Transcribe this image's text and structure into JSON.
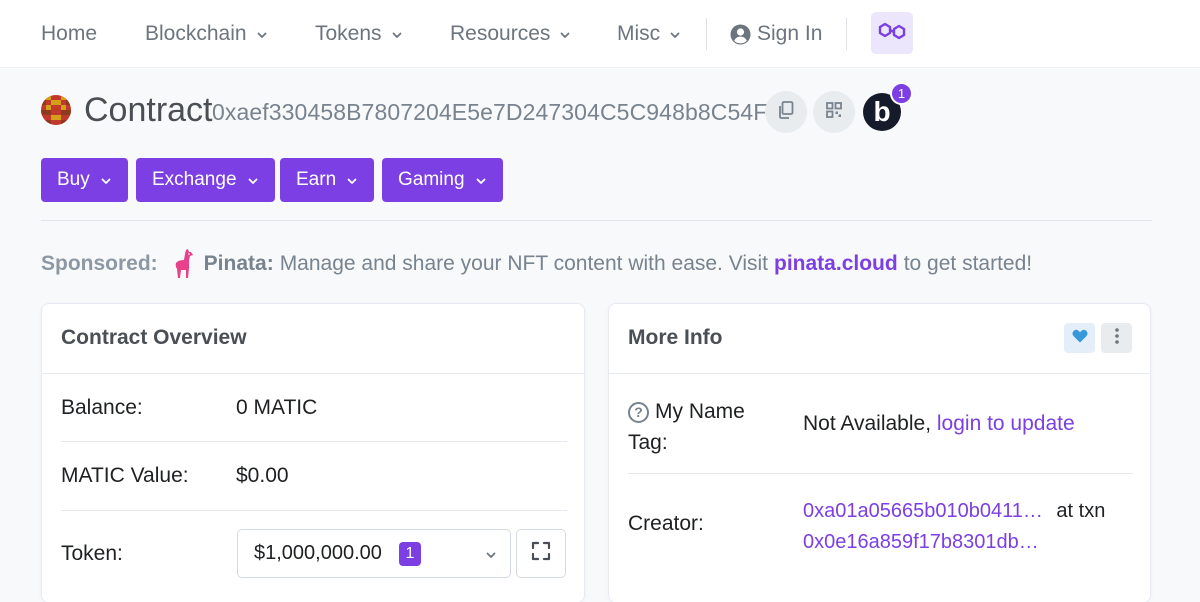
{
  "nav": {
    "home": "Home",
    "blockchain": "Blockchain",
    "tokens": "Tokens",
    "resources": "Resources",
    "misc": "Misc",
    "sign_in": "Sign In"
  },
  "header": {
    "title": "Contract",
    "address": "0xaef330458B7807204E5e7D247304C5C948b8C54F",
    "blockscan_letter": "b",
    "blockscan_badge": "1"
  },
  "actions": {
    "buy": "Buy",
    "exchange": "Exchange",
    "earn": "Earn",
    "gaming": "Gaming"
  },
  "sponsored": {
    "label": "Sponsored:",
    "brand": "Pinata:",
    "text": "Manage and share your NFT content with ease. Visit",
    "link": "pinata.cloud",
    "suffix": "to get started!"
  },
  "overview": {
    "title": "Contract Overview",
    "balance_label": "Balance:",
    "balance_value": "0 MATIC",
    "value_label": "MATIC Value:",
    "value_value": "$0.00",
    "token_label": "Token:",
    "token_value": "$1,000,000.00",
    "token_count": "1"
  },
  "more_info": {
    "title": "More Info",
    "name_tag_label_1": "My Name",
    "name_tag_label_2": "Tag:",
    "name_tag_value": "Not Available,",
    "name_tag_link": "login to update",
    "creator_label": "Creator:",
    "creator_address": "0xa01a05665b010b0411…",
    "at_txn": "at txn",
    "creator_txn": "0x0e16a859f17b8301db…"
  },
  "colors": {
    "accent": "#7b3fe4",
    "text_muted": "#77838f",
    "heart": "#3498db"
  }
}
